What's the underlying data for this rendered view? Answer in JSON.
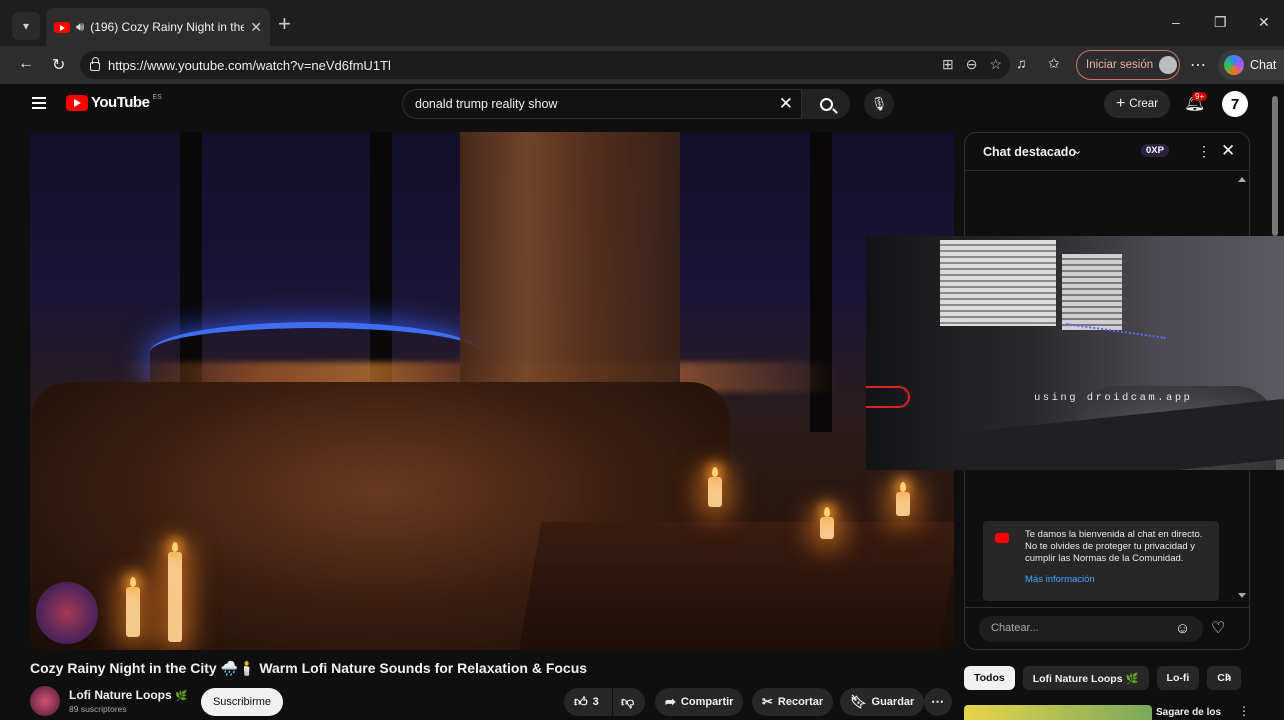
{
  "browser": {
    "tab_title": "(196) Cozy Rainy Night in the",
    "url": "https://www.youtube.com/watch?v=neVd6fmU1Tl",
    "signin_label": "Iniciar sesión",
    "chat_label": "Chat",
    "window_buttons": [
      "–",
      "❐",
      "✕"
    ]
  },
  "youtube": {
    "logo_text": "YouTube",
    "logo_country": "ES",
    "search_query": "donald trump reality show",
    "create_label": "Crear",
    "notification_badge": "9+"
  },
  "live_chat": {
    "title": "Chat destacado",
    "points_badge": "0XP",
    "welcome_text": "Te damos la bienvenida al chat en directo. No te olvides de proteger tu privacidad y cumplir las Normas de la Comunidad.",
    "welcome_link": "Más información",
    "input_placeholder": "Chatear..."
  },
  "camera_overlay": {
    "watermark": "using droidcam.app"
  },
  "video": {
    "title": "Cozy Rainy Night in the City 🌧️🕯️ Warm Lofi Nature Sounds for Relaxation & Focus",
    "channel_name": "Lofi Nature Loops",
    "channel_leaf": "🌿",
    "subscribers": "89 suscriptores",
    "subscribe_label": "Suscribirme",
    "like_count": "3",
    "share_label": "Compartir",
    "clip_label": "Recortar",
    "save_label": "Guardar"
  },
  "recommendations": {
    "chips": [
      "Todos",
      "Lofi Nature Loops 🌿",
      "Lo-fi",
      "Ch"
    ],
    "first_title": "Sagare de los"
  },
  "icons": {
    "tab_list": "chevron-down-icon",
    "back": "back-arrow-icon",
    "reload": "reload-icon",
    "lock": "lock-icon",
    "search": "search-icon",
    "mic": "microphone-icon",
    "bell": "bell-icon"
  },
  "colors": {
    "youtube_red": "#ff0000",
    "link_blue": "#3ea6ff",
    "background": "#0f0f0f"
  }
}
